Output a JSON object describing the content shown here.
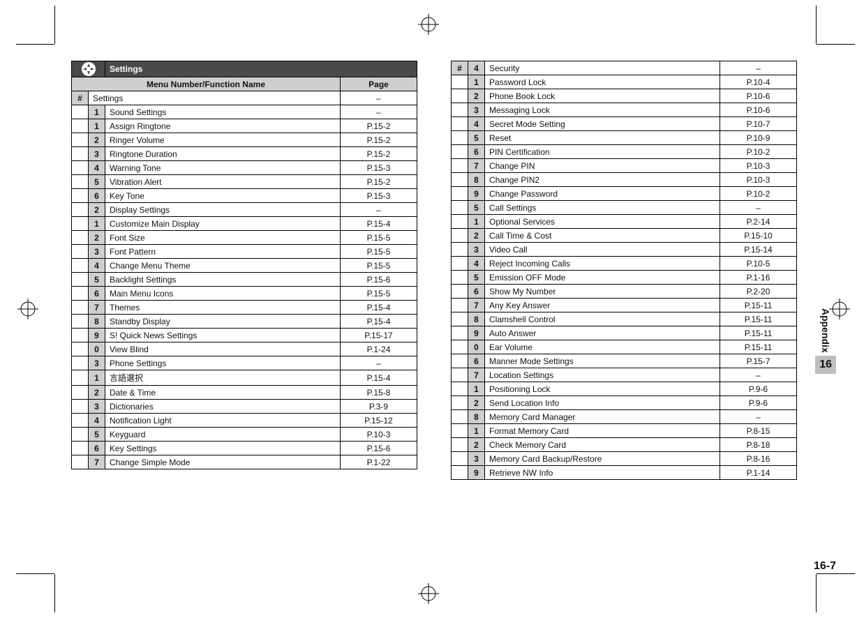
{
  "section": {
    "title": "Settings",
    "appendix": "Appendix",
    "chapter": "16",
    "page_number": "16-7"
  },
  "table_header": {
    "menu": "Menu Number/Function Name",
    "page": "Page"
  },
  "left": [
    {
      "type": "root",
      "num": "#",
      "name": "Settings",
      "page": "–"
    },
    {
      "type": "group",
      "num": "1",
      "name": "Sound Settings",
      "page": "–"
    },
    {
      "type": "item",
      "num": "1",
      "name": "Assign Ringtone",
      "page": "P.15-2"
    },
    {
      "type": "item",
      "num": "2",
      "name": "Ringer Volume",
      "page": "P.15-2"
    },
    {
      "type": "item",
      "num": "3",
      "name": "Ringtone Duration",
      "page": "P.15-2"
    },
    {
      "type": "item",
      "num": "4",
      "name": "Warning Tone",
      "page": "P.15-3"
    },
    {
      "type": "item",
      "num": "5",
      "name": "Vibration Alert",
      "page": "P.15-2"
    },
    {
      "type": "item",
      "num": "6",
      "name": "Key Tone",
      "page": "P.15-3"
    },
    {
      "type": "group",
      "num": "2",
      "name": "Display Settings",
      "page": "–"
    },
    {
      "type": "item",
      "num": "1",
      "name": "Customize Main Display",
      "page": "P.15-4"
    },
    {
      "type": "item",
      "num": "2",
      "name": "Font Size",
      "page": "P.15-5"
    },
    {
      "type": "item",
      "num": "3",
      "name": "Font Pattern",
      "page": "P.15-5"
    },
    {
      "type": "item",
      "num": "4",
      "name": "Change Menu Theme",
      "page": "P.15-5"
    },
    {
      "type": "item",
      "num": "5",
      "name": "Backlight Settings",
      "page": "P.15-6"
    },
    {
      "type": "item",
      "num": "6",
      "name": "Main Menu Icons",
      "page": "P.15-5"
    },
    {
      "type": "item",
      "num": "7",
      "name": "Themes",
      "page": "P.15-4"
    },
    {
      "type": "item",
      "num": "8",
      "name": "Standby Display",
      "page": "P.15-4"
    },
    {
      "type": "item",
      "num": "9",
      "name": "S! Quick News Settings",
      "page": "P.15-17"
    },
    {
      "type": "item",
      "num": "0",
      "name": "View Blind",
      "page": "P.1-24"
    },
    {
      "type": "group",
      "num": "3",
      "name": "Phone Settings",
      "page": "–"
    },
    {
      "type": "item",
      "num": "1",
      "name": "言語選択",
      "page": "P.15-4"
    },
    {
      "type": "item",
      "num": "2",
      "name": "Date & Time",
      "page": "P.15-8"
    },
    {
      "type": "item",
      "num": "3",
      "name": "Dictionaries",
      "page": "P.3-9"
    },
    {
      "type": "item",
      "num": "4",
      "name": "Notification Light",
      "page": "P.15-12"
    },
    {
      "type": "item",
      "num": "5",
      "name": "Keyguard",
      "page": "P.10-3"
    },
    {
      "type": "item",
      "num": "6",
      "name": "Key Settings",
      "page": "P.15-6"
    },
    {
      "type": "item",
      "num": "7",
      "name": "Change Simple Mode",
      "page": "P.1-22"
    }
  ],
  "right": [
    {
      "type": "root_group",
      "root": "#",
      "num": "4",
      "name": "Security",
      "page": "–"
    },
    {
      "type": "item",
      "num": "1",
      "name": "Password Lock",
      "page": "P.10-4"
    },
    {
      "type": "item",
      "num": "2",
      "name": "Phone Book Lock",
      "page": "P.10-6"
    },
    {
      "type": "item",
      "num": "3",
      "name": "Messaging Lock",
      "page": "P.10-6"
    },
    {
      "type": "item",
      "num": "4",
      "name": "Secret Mode Setting",
      "page": "P.10-7"
    },
    {
      "type": "item",
      "num": "5",
      "name": "Reset",
      "page": "P.10-9"
    },
    {
      "type": "item",
      "num": "6",
      "name": "PIN Certification",
      "page": "P.10-2"
    },
    {
      "type": "item",
      "num": "7",
      "name": "Change PIN",
      "page": "P.10-3"
    },
    {
      "type": "item",
      "num": "8",
      "name": "Change PIN2",
      "page": "P.10-3"
    },
    {
      "type": "item",
      "num": "9",
      "name": "Change Password",
      "page": "P.10-2"
    },
    {
      "type": "group",
      "num": "5",
      "name": "Call Settings",
      "page": "–"
    },
    {
      "type": "item",
      "num": "1",
      "name": "Optional Services",
      "page": "P.2-14"
    },
    {
      "type": "item",
      "num": "2",
      "name": "Call Time & Cost",
      "page": "P.15-10"
    },
    {
      "type": "item",
      "num": "3",
      "name": "Video Call",
      "page": "P.15-14"
    },
    {
      "type": "item",
      "num": "4",
      "name": "Reject Incoming Calls",
      "page": "P.10-5"
    },
    {
      "type": "item",
      "num": "5",
      "name": "Emission OFF Mode",
      "page": "P.1-16"
    },
    {
      "type": "item",
      "num": "6",
      "name": "Show My Number",
      "page": "P.2-20"
    },
    {
      "type": "item",
      "num": "7",
      "name": "Any Key Answer",
      "page": "P.15-11"
    },
    {
      "type": "item",
      "num": "8",
      "name": "Clamshell Control",
      "page": "P.15-11"
    },
    {
      "type": "item",
      "num": "9",
      "name": "Auto Answer",
      "page": "P.15-11"
    },
    {
      "type": "item",
      "num": "0",
      "name": "Ear Volume",
      "page": "P.15-11"
    },
    {
      "type": "group",
      "num": "6",
      "name": "Manner Mode Settings",
      "page": "P.15-7"
    },
    {
      "type": "group",
      "num": "7",
      "name": "Location Settings",
      "page": "–"
    },
    {
      "type": "item",
      "num": "1",
      "name": "Positioning Lock",
      "page": "P.9-6"
    },
    {
      "type": "item",
      "num": "2",
      "name": "Send Location Info",
      "page": "P.9-6"
    },
    {
      "type": "group",
      "num": "8",
      "name": "Memory Card Manager",
      "page": "–"
    },
    {
      "type": "item",
      "num": "1",
      "name": "Format Memory Card",
      "page": "P.8-15"
    },
    {
      "type": "item",
      "num": "2",
      "name": "Check Memory Card",
      "page": "P.8-18"
    },
    {
      "type": "item",
      "num": "3",
      "name": "Memory Card Backup/Restore",
      "page": "P.8-16"
    },
    {
      "type": "group",
      "num": "9",
      "name": "Retrieve NW Info",
      "page": "P.1-14"
    }
  ]
}
